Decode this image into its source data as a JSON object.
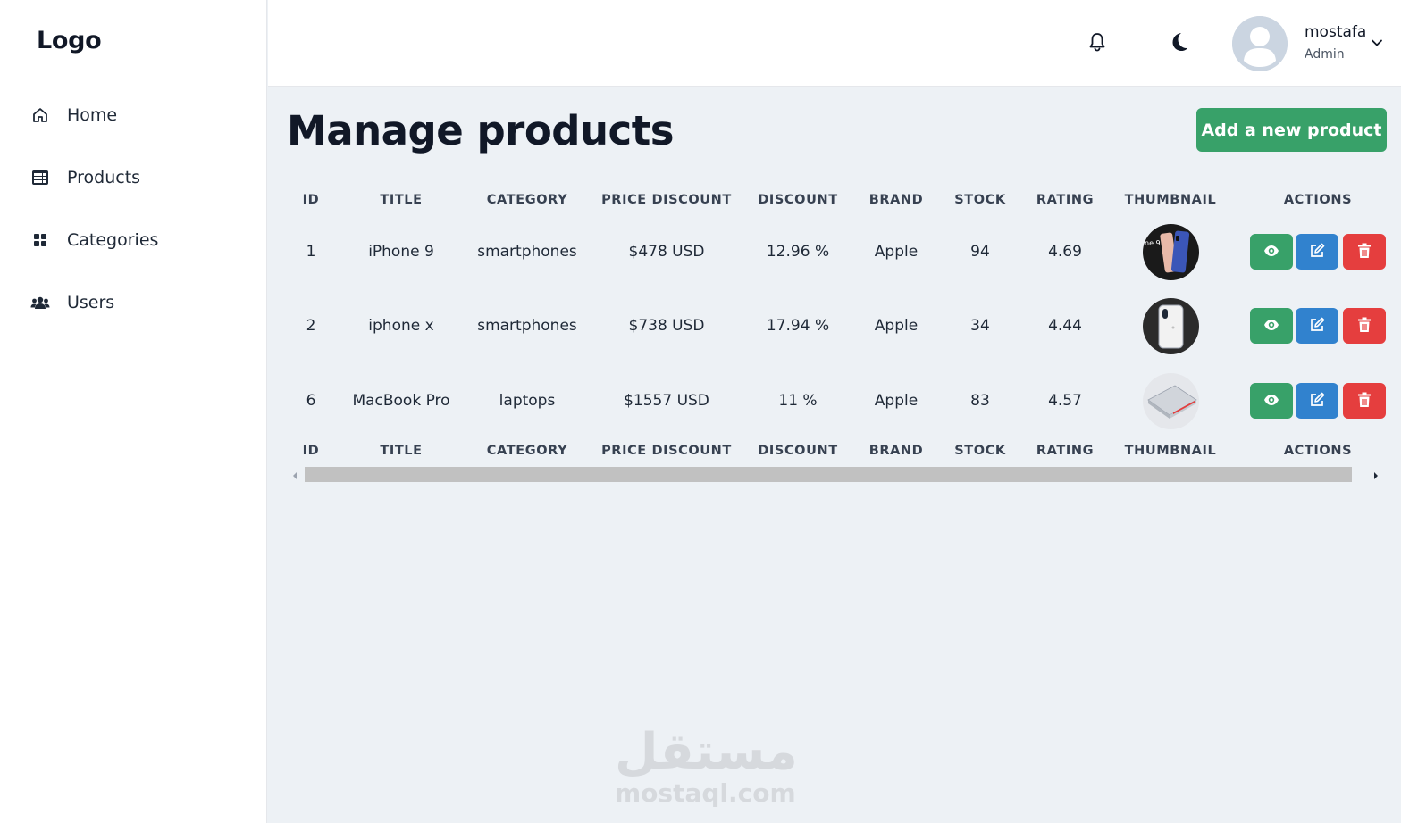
{
  "sidebar": {
    "logo": "Logo",
    "items": [
      {
        "label": "Home",
        "icon": "home-icon"
      },
      {
        "label": "Products",
        "icon": "table-icon"
      },
      {
        "label": "Categories",
        "icon": "grid-icon"
      },
      {
        "label": "Users",
        "icon": "users-icon"
      }
    ]
  },
  "header": {
    "notifications_icon": "bell-icon",
    "theme_icon": "moon-icon",
    "user": {
      "name": "mostafa",
      "role": "Admin"
    }
  },
  "main": {
    "title": "Manage products",
    "add_button": "Add a new product"
  },
  "table": {
    "columns": [
      "ID",
      "TITLE",
      "CATEGORY",
      "PRICE DISCOUNT",
      "DISCOUNT",
      "BRAND",
      "STOCK",
      "RATING",
      "THUMBNAIL",
      "ACTIONS"
    ],
    "rows": [
      {
        "id": "1",
        "title": "iPhone 9",
        "category": "smartphones",
        "price": "$478 USD",
        "discount": "12.96 %",
        "brand": "Apple",
        "stock": "94",
        "rating": "4.69",
        "thumbnail": "iphone-9-thumbnail"
      },
      {
        "id": "2",
        "title": "iphone x",
        "category": "smartphones",
        "price": "$738 USD",
        "discount": "17.94 %",
        "brand": "Apple",
        "stock": "34",
        "rating": "4.44",
        "thumbnail": "iphone-x-thumbnail"
      },
      {
        "id": "6",
        "title": "MacBook Pro",
        "category": "laptops",
        "price": "$1557 USD",
        "discount": "11 %",
        "brand": "Apple",
        "stock": "83",
        "rating": "4.57",
        "thumbnail": "macbook-pro-thumbnail"
      }
    ],
    "action_icons": [
      "eye-icon",
      "edit-icon",
      "trash-icon"
    ]
  },
  "colors": {
    "primary_green": "#38a169",
    "edit_blue": "#3182ce",
    "delete_red": "#e53e3e",
    "page_bg": "#edf1f5"
  },
  "watermark": {
    "arabic": "مستقل",
    "latin": "mostaql.com"
  }
}
